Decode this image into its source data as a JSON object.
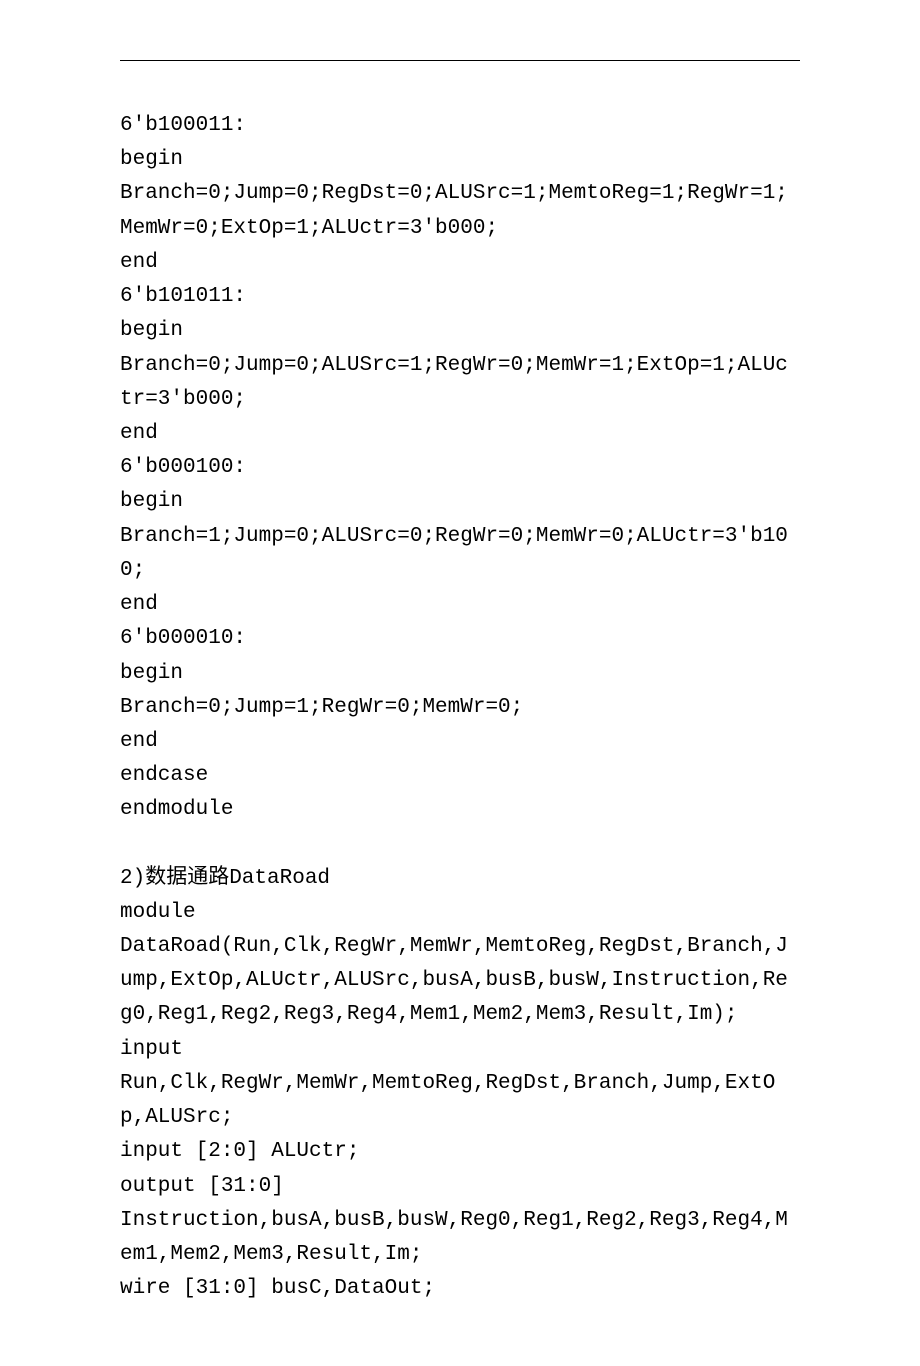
{
  "lines": [
    "6'b100011:",
    "begin",
    "Branch=0;Jump=0;RegDst=0;ALUSrc=1;MemtoReg=1;RegWr=1;MemWr=0;ExtOp=1;ALUctr=3'b000;",
    "end",
    "6'b101011:",
    "begin",
    "Branch=0;Jump=0;ALUSrc=1;RegWr=0;MemWr=1;ExtOp=1;ALUctr=3'b000;",
    "end",
    "6'b000100:",
    "begin",
    "Branch=1;Jump=0;ALUSrc=0;RegWr=0;MemWr=0;ALUctr=3'b100;",
    "end",
    "6'b000010:",
    "begin",
    "Branch=0;Jump=1;RegWr=0;MemWr=0;",
    "end",
    "endcase",
    "endmodule",
    "",
    "2)数据通路DataRoad",
    "module",
    "DataRoad(Run,Clk,RegWr,MemWr,MemtoReg,RegDst,Branch,Jump,ExtOp,ALUctr,ALUSrc,busA,busB,busW,Instruction,Reg0,Reg1,Reg2,Reg3,Reg4,Mem1,Mem2,Mem3,Result,Im);",
    "input",
    "Run,Clk,RegWr,MemWr,MemtoReg,RegDst,Branch,Jump,ExtOp,ALUSrc;",
    "input [2:0] ALUctr;",
    "output [31:0]",
    "Instruction,busA,busB,busW,Reg0,Reg1,Reg2,Reg3,Reg4,Mem1,Mem2,Mem3,Result,Im;",
    "wire [31:0] busC,DataOut;"
  ]
}
